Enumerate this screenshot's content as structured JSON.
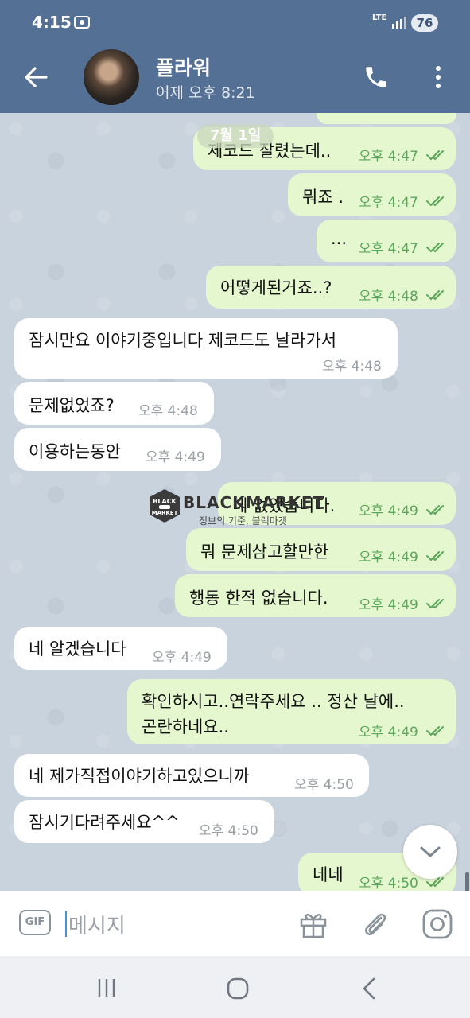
{
  "status": {
    "time": "4:15",
    "network": "LTE",
    "battery": "76"
  },
  "header": {
    "name": "플라워",
    "last_seen": "어제 오후 8:21"
  },
  "chat": {
    "date_label": "7월 1일",
    "messages": [
      {
        "dir": "out",
        "text": "",
        "time": ""
      },
      {
        "dir": "out",
        "text": "제코드 잘렸는데..",
        "time": "오후 4:47"
      },
      {
        "dir": "out",
        "text": "뭐죠 .",
        "time": "오후 4:47"
      },
      {
        "dir": "out",
        "text": "...",
        "time": "오후 4:47"
      },
      {
        "dir": "out",
        "text": "어떻게된거죠..?",
        "time": "오후 4:48"
      },
      {
        "dir": "in",
        "text": "잠시만요 이야기중입니다 제코드도 날라가서",
        "time": "오후 4:48"
      },
      {
        "dir": "in",
        "text": "문제없었죠?",
        "time": "오후 4:48"
      },
      {
        "dir": "in",
        "text": "이용하는동안",
        "time": "오후 4:49"
      },
      {
        "dir": "out",
        "text": "네 없었습니다.",
        "time": "오후 4:49"
      },
      {
        "dir": "out",
        "text": "뭐 문제삼고할만한",
        "time": "오후 4:49"
      },
      {
        "dir": "out",
        "text": "행동 한적 없습니다.",
        "time": "오후 4:49"
      },
      {
        "dir": "in",
        "text": "네 알겠습니다",
        "time": "오후 4:49"
      },
      {
        "dir": "out",
        "text": "확인하시고..연락주세요 .. 정산 날에..",
        "text2": "곤란하네요..",
        "time": "오후 4:49"
      },
      {
        "dir": "in",
        "text": "네 제가직접이야기하고있으니까",
        "time": "오후 4:50"
      },
      {
        "dir": "in",
        "text": "잠시기다려주세요^^",
        "time": "오후 4:50"
      },
      {
        "dir": "out",
        "text": "네네",
        "time": "오후 4:50"
      }
    ]
  },
  "watermark": {
    "logo_line1": "BLACK",
    "logo_line2": "MARKET",
    "title": "BLACKMARKET",
    "subtitle": "정보의 기준, 블랙마켓"
  },
  "input": {
    "gif_label": "GIF",
    "placeholder": "메시지"
  },
  "icons": {
    "back": "arrow-left-icon",
    "call": "phone-icon",
    "more": "more-vertical-icon",
    "gift": "gift-icon",
    "attach": "paperclip-icon",
    "camera": "instagram-camera-icon"
  },
  "colors": {
    "header": "#557095",
    "outgoing_bubble": "#e5f7cf",
    "incoming_bubble": "#ffffff",
    "check": "#5ba65a"
  }
}
